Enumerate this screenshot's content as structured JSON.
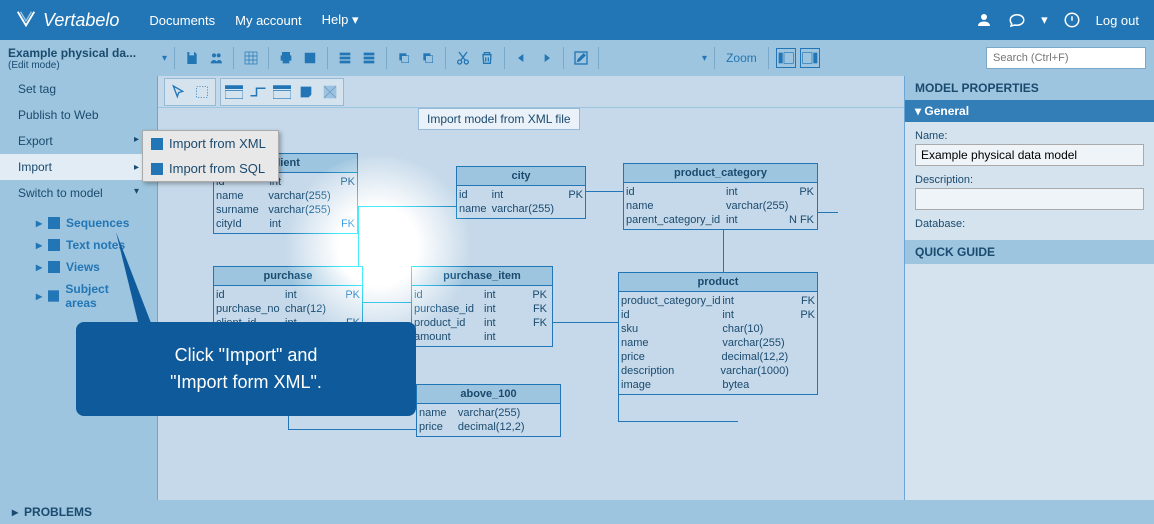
{
  "topbar": {
    "logo": "Vertabelo",
    "links": [
      "Documents",
      "My account",
      "Help"
    ],
    "logout": "Log out"
  },
  "docbar": {
    "title": "Example physical da...",
    "mode": "(Edit mode)",
    "zoom": "Zoom",
    "search_placeholder": "Search (Ctrl+F)"
  },
  "leftmenu": {
    "items": [
      "Set tag",
      "Publish to Web",
      "Export",
      "Import",
      "Switch to model"
    ],
    "tree": [
      "Sequences",
      "Text notes",
      "Views",
      "Subject areas"
    ]
  },
  "submenu": {
    "items": [
      "Import from XML",
      "Import from SQL"
    ]
  },
  "tooltip": "Import model from XML file",
  "entities": {
    "client": {
      "name": "client",
      "rows": [
        [
          "id",
          "int",
          "PK"
        ],
        [
          "name",
          "varchar(255)",
          ""
        ],
        [
          "surname",
          "varchar(255)",
          ""
        ],
        [
          "cityId",
          "int",
          "FK"
        ]
      ]
    },
    "city": {
      "name": "city",
      "rows": [
        [
          "id",
          "int",
          "PK"
        ],
        [
          "name",
          "varchar(255)",
          ""
        ]
      ]
    },
    "product_category": {
      "name": "product_category",
      "rows": [
        [
          "id",
          "int",
          "PK"
        ],
        [
          "name",
          "varchar(255)",
          ""
        ],
        [
          "parent_category_id",
          "int",
          "N FK"
        ]
      ]
    },
    "purchase": {
      "name": "purchase",
      "rows": [
        [
          "id",
          "int",
          "PK"
        ],
        [
          "purchase_no",
          "char(12)",
          ""
        ],
        [
          "client_id",
          "int",
          "FK"
        ]
      ]
    },
    "purchase_item": {
      "name": "purchase_item",
      "rows": [
        [
          "id",
          "int",
          "PK"
        ],
        [
          "purchase_id",
          "int",
          "FK"
        ],
        [
          "product_id",
          "int",
          "FK"
        ],
        [
          "amount",
          "int",
          ""
        ]
      ]
    },
    "product": {
      "name": "product",
      "rows": [
        [
          "product_category_id",
          "int",
          "FK"
        ],
        [
          "id",
          "int",
          "PK"
        ],
        [
          "sku",
          "char(10)",
          ""
        ],
        [
          "name",
          "varchar(255)",
          ""
        ],
        [
          "price",
          "decimal(12,2)",
          ""
        ],
        [
          "description",
          "varchar(1000)",
          ""
        ],
        [
          "image",
          "bytea",
          ""
        ]
      ]
    },
    "above_100": {
      "name": "above_100",
      "rows": [
        [
          "name",
          "varchar(255)",
          ""
        ],
        [
          "price",
          "decimal(12,2)",
          ""
        ]
      ]
    }
  },
  "rightpanel": {
    "header": "MODEL PROPERTIES",
    "section": "General",
    "name_label": "Name:",
    "name_value": "Example physical data model",
    "desc_label": "Description:",
    "desc_value": "",
    "db_label": "Database:",
    "quickguide": "QUICK GUIDE"
  },
  "bottom": "PROBLEMS",
  "callout": {
    "line1": "Click \"Import\" and",
    "line2": "\"Import form XML\"."
  }
}
